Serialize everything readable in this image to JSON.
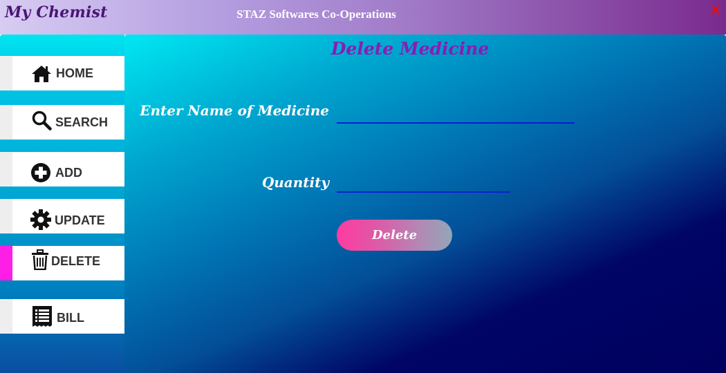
{
  "window": {
    "app_title": "My Chemist",
    "company": "STAZ Softwares Co-Operations",
    "close_label": "X"
  },
  "sidebar": {
    "items": [
      {
        "label": "HOME",
        "icon": "home-icon",
        "active": false
      },
      {
        "label": "SEARCH",
        "icon": "search-icon",
        "active": false
      },
      {
        "label": "ADD",
        "icon": "add-icon",
        "active": false
      },
      {
        "label": "UPDATE",
        "icon": "gear-icon",
        "active": false
      },
      {
        "label": "DELETE",
        "icon": "trash-icon",
        "active": true
      },
      {
        "label": "BILL",
        "icon": "receipt-icon",
        "active": false
      }
    ]
  },
  "main": {
    "title": "Delete Medicine",
    "name_label": "Enter Name of Medicine",
    "name_value": "",
    "quantity_label": "Quantity",
    "quantity_value": "",
    "delete_label": "Delete"
  },
  "colors": {
    "active_indicator": "#ff1ee6",
    "title": "#8a1cb4",
    "input_underline": "#0b1fd0",
    "close": "#e01010"
  }
}
